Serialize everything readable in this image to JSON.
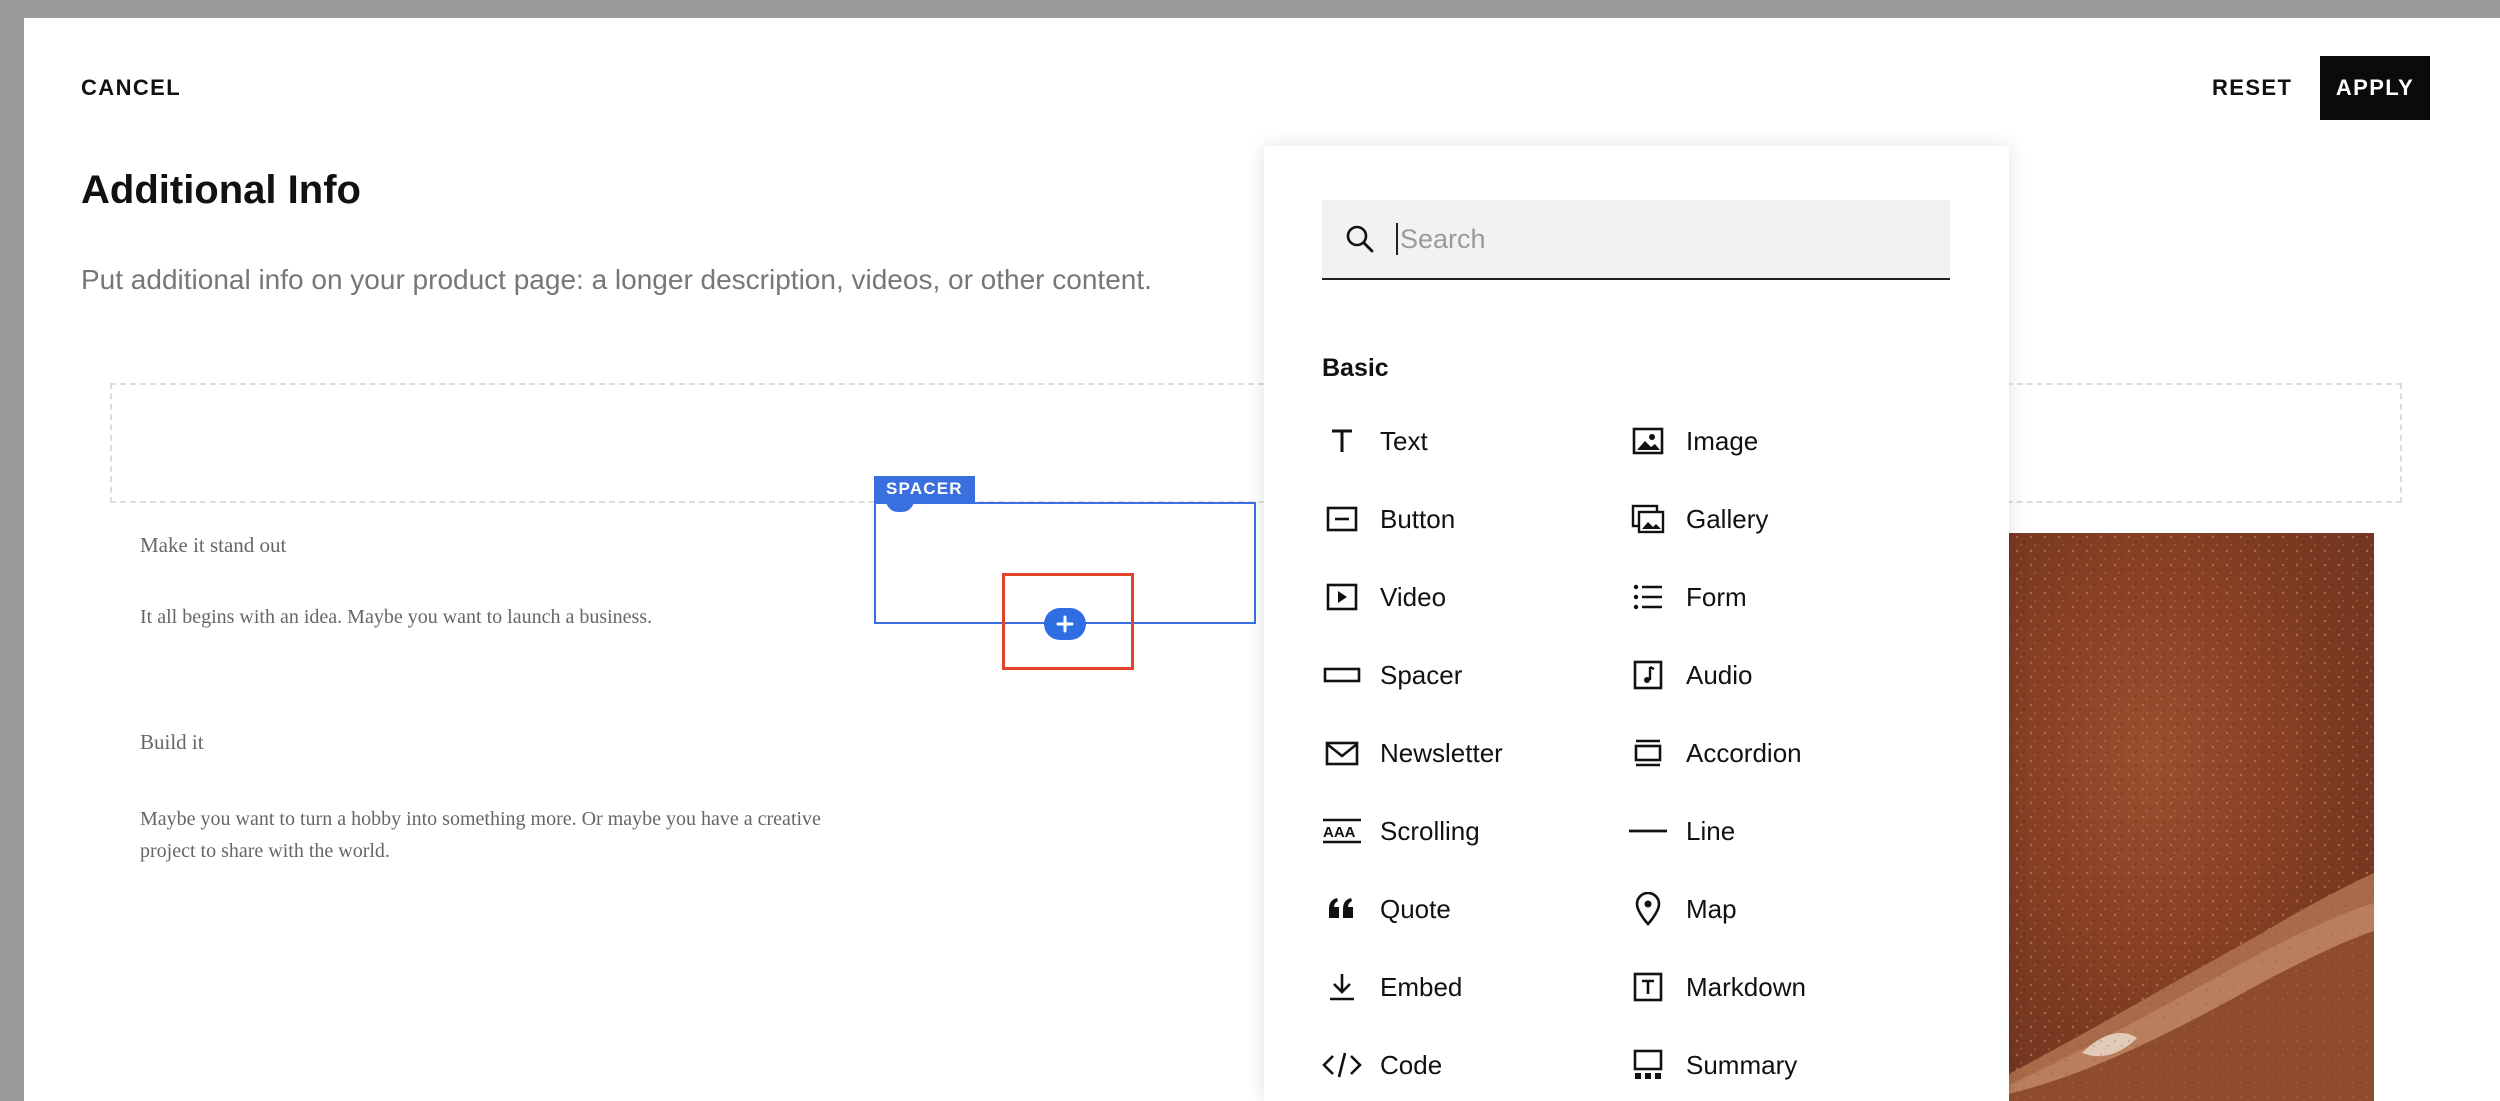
{
  "header": {
    "cancel_label": "CANCEL",
    "reset_label": "RESET",
    "apply_label": "APPLY"
  },
  "page": {
    "title": "Additional Info",
    "subtitle": "Put additional info on your product page: a longer description, videos, or other content."
  },
  "content": {
    "heading_1": "Make it stand out",
    "paragraph_1": "It all begins with an idea. Maybe you want to launch a business.",
    "heading_2": "Build it",
    "paragraph_2": "Maybe you want to turn a hobby into something more. Or maybe you have a creative project to share with the world."
  },
  "spacer": {
    "tag_label": "SPACER",
    "add_icon": "plus-icon"
  },
  "block_picker": {
    "search": {
      "placeholder": "Search",
      "value": ""
    },
    "section_label": "Basic",
    "items": [
      {
        "label": "Text",
        "icon": "text-icon"
      },
      {
        "label": "Image",
        "icon": "image-icon"
      },
      {
        "label": "Button",
        "icon": "button-icon"
      },
      {
        "label": "Gallery",
        "icon": "gallery-icon"
      },
      {
        "label": "Video",
        "icon": "video-icon"
      },
      {
        "label": "Form",
        "icon": "form-icon"
      },
      {
        "label": "Spacer",
        "icon": "spacer-icon"
      },
      {
        "label": "Audio",
        "icon": "audio-icon"
      },
      {
        "label": "Newsletter",
        "icon": "newsletter-icon"
      },
      {
        "label": "Accordion",
        "icon": "accordion-icon"
      },
      {
        "label": "Scrolling",
        "icon": "scrolling-icon"
      },
      {
        "label": "Line",
        "icon": "line-icon"
      },
      {
        "label": "Quote",
        "icon": "quote-icon"
      },
      {
        "label": "Map",
        "icon": "map-icon"
      },
      {
        "label": "Embed",
        "icon": "embed-icon"
      },
      {
        "label": "Markdown",
        "icon": "markdown-icon"
      },
      {
        "label": "Code",
        "icon": "code-icon"
      },
      {
        "label": "Summary",
        "icon": "summary-icon"
      }
    ]
  },
  "colors": {
    "accent_blue": "#3a6fe0",
    "highlight_red": "#e2432b",
    "apply_bg": "#0b0b0b"
  }
}
